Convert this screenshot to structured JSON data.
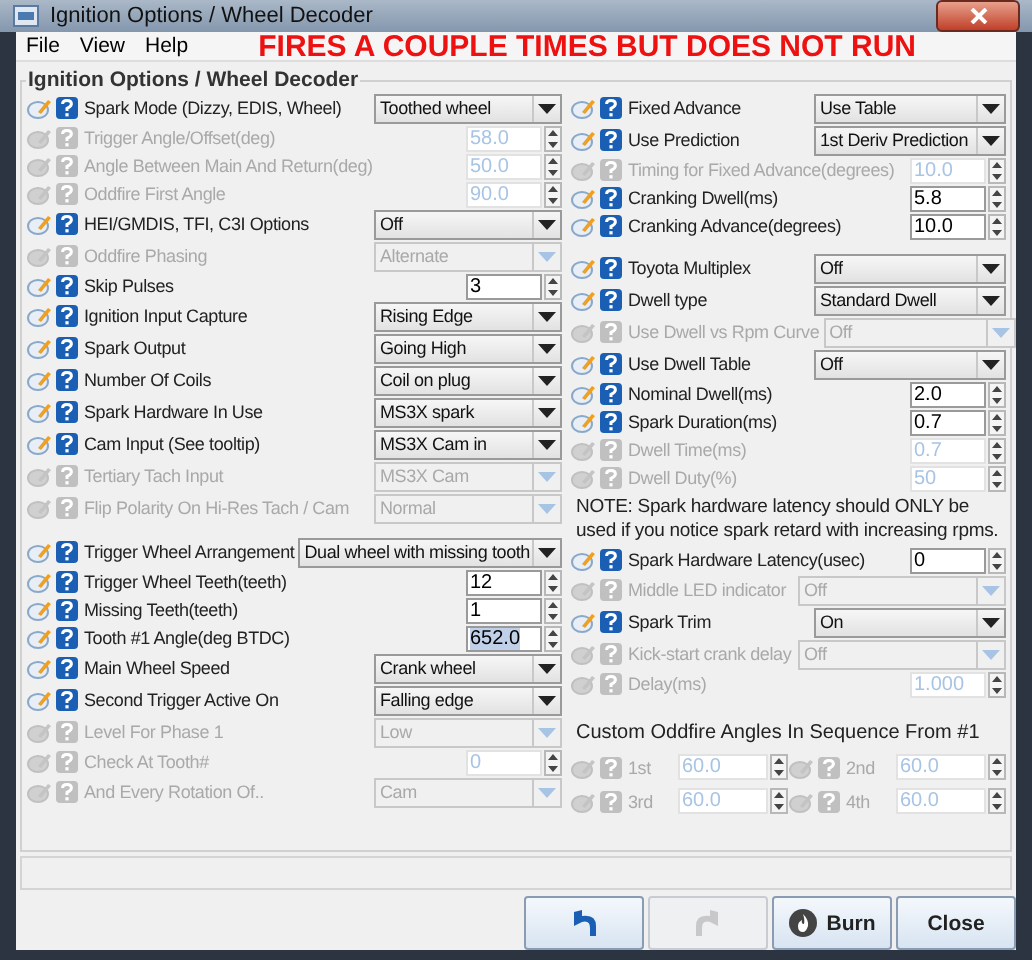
{
  "window": {
    "title": "Ignition Options / Wheel Decoder"
  },
  "menu": [
    "File",
    "View",
    "Help"
  ],
  "annotation": "FIRES A COUPLE TIMES BUT DOES NOT RUN",
  "group": {
    "title": "Ignition Options / Wheel Decoder"
  },
  "left": [
    {
      "kind": "select",
      "label": "Spark Mode (Dizzy, EDIS, Wheel)",
      "value": "Toothed wheel",
      "disabled": false
    },
    {
      "kind": "number",
      "label": "Trigger Angle/Offset(deg)",
      "value": "58.0",
      "disabled": true,
      "focused": false
    },
    {
      "kind": "number",
      "label": "Angle Between Main And Return(deg)",
      "value": "50.0",
      "disabled": true,
      "focused": false
    },
    {
      "kind": "number",
      "label": "Oddfire First Angle",
      "value": "90.0",
      "disabled": true,
      "focused": false
    },
    {
      "kind": "select",
      "label": "HEI/GMDIS, TFI, C3I Options",
      "value": "Off",
      "disabled": false
    },
    {
      "kind": "select",
      "label": "Oddfire Phasing",
      "value": "Alternate",
      "disabled": true
    },
    {
      "kind": "number",
      "label": "Skip Pulses",
      "value": "3",
      "disabled": false,
      "focused": false
    },
    {
      "kind": "select",
      "label": "Ignition Input Capture",
      "value": "Rising Edge",
      "disabled": false
    },
    {
      "kind": "select",
      "label": "Spark Output",
      "value": "Going High",
      "disabled": false
    },
    {
      "kind": "select",
      "label": "Number Of Coils",
      "value": "Coil on plug",
      "disabled": false
    },
    {
      "kind": "select",
      "label": "Spark Hardware In Use",
      "value": "MS3X spark",
      "disabled": false
    },
    {
      "kind": "select",
      "label": "Cam Input (See tooltip)",
      "value": "MS3X Cam in",
      "disabled": false
    },
    {
      "kind": "select",
      "label": "Tertiary Tach Input",
      "value": "MS3X Cam",
      "disabled": true
    },
    {
      "kind": "select",
      "label": "Flip Polarity On Hi-Res Tach / Cam",
      "value": "Normal",
      "disabled": true
    },
    {
      "kind": "gap"
    },
    {
      "kind": "wide",
      "label": "Trigger Wheel Arrangement",
      "value": "Dual wheel with missing tooth",
      "disabled": false
    },
    {
      "kind": "number",
      "label": "Trigger Wheel Teeth(teeth)",
      "value": "12",
      "disabled": false,
      "focused": false
    },
    {
      "kind": "number",
      "label": "Missing Teeth(teeth)",
      "value": "1",
      "disabled": false,
      "focused": false
    },
    {
      "kind": "number",
      "label": "Tooth #1 Angle(deg BTDC)",
      "value": "652.0",
      "disabled": false,
      "focused": true
    },
    {
      "kind": "select",
      "label": "Main Wheel Speed",
      "value": "Crank wheel",
      "disabled": false
    },
    {
      "kind": "select",
      "label": "Second Trigger Active On",
      "value": "Falling edge",
      "disabled": false
    },
    {
      "kind": "select",
      "label": "Level For Phase 1",
      "value": "Low",
      "disabled": true
    },
    {
      "kind": "number",
      "label": "Check At Tooth#",
      "value": "0",
      "disabled": true,
      "focused": false
    },
    {
      "kind": "select",
      "label": "And Every Rotation Of..",
      "value": "Cam",
      "disabled": true
    }
  ],
  "right": [
    {
      "kind": "select",
      "label": "Fixed Advance",
      "value": "Use Table",
      "disabled": false
    },
    {
      "kind": "select",
      "label": "Use Prediction",
      "value": "1st Deriv Prediction",
      "disabled": false
    },
    {
      "kind": "number",
      "label": "Timing for Fixed Advance(degrees)",
      "value": "10.0",
      "disabled": true,
      "focused": false
    },
    {
      "kind": "number",
      "label": "Cranking Dwell(ms)",
      "value": "5.8",
      "disabled": false,
      "focused": false
    },
    {
      "kind": "number",
      "label": "Cranking Advance(degrees)",
      "value": "10.0",
      "disabled": false,
      "focused": false
    },
    {
      "kind": "gap"
    },
    {
      "kind": "select",
      "label": "Toyota Multiplex",
      "value": "Off",
      "disabled": false
    },
    {
      "kind": "select",
      "label": "Dwell type",
      "value": "Standard Dwell",
      "disabled": false
    },
    {
      "kind": "select",
      "label": "Use Dwell vs Rpm Curve",
      "value": "Off",
      "disabled": true
    },
    {
      "kind": "select",
      "label": "Use Dwell Table",
      "value": "Off",
      "disabled": false
    },
    {
      "kind": "number",
      "label": "Nominal Dwell(ms)",
      "value": "2.0",
      "disabled": false,
      "focused": false
    },
    {
      "kind": "number",
      "label": "Spark Duration(ms)",
      "value": "0.7",
      "disabled": false,
      "focused": false
    },
    {
      "kind": "number",
      "label": "Dwell Time(ms)",
      "value": "0.7",
      "disabled": true,
      "focused": false
    },
    {
      "kind": "number",
      "label": "Dwell Duty(%)",
      "value": "50",
      "disabled": true,
      "focused": false
    },
    {
      "kind": "note",
      "text": "NOTE: Spark hardware latency should ONLY be used if you notice spark retard with increasing rpms."
    },
    {
      "kind": "number",
      "label": "Spark Hardware Latency(usec)",
      "value": "0",
      "disabled": false,
      "focused": false
    },
    {
      "kind": "wide",
      "label": "Middle LED indicator",
      "value": "Off",
      "disabled": true
    },
    {
      "kind": "select",
      "label": "Spark Trim",
      "value": "On",
      "disabled": false
    },
    {
      "kind": "wide",
      "label": "Kick-start crank delay",
      "value": "Off",
      "disabled": true
    },
    {
      "kind": "number",
      "label": "Delay(ms)",
      "value": "1.000",
      "disabled": true,
      "focused": false
    },
    {
      "kind": "gap"
    },
    {
      "kind": "heading",
      "text": "Custom Oddfire Angles In Sequence From #1"
    },
    {
      "kind": "pair",
      "items": [
        {
          "label": "1st",
          "value": "60.0",
          "disabled": true
        },
        {
          "label": "2nd",
          "value": "60.0",
          "disabled": true
        }
      ]
    },
    {
      "kind": "pair",
      "items": [
        {
          "label": "3rd",
          "value": "60.0",
          "disabled": true
        },
        {
          "label": "4th",
          "value": "60.0",
          "disabled": true
        }
      ]
    }
  ],
  "buttons": [
    {
      "kind": "undo",
      "disabled": false
    },
    {
      "kind": "redo",
      "disabled": true
    },
    {
      "kind": "burn",
      "label": "Burn",
      "disabled": false
    },
    {
      "kind": "close",
      "label": "Close",
      "disabled": false
    }
  ]
}
